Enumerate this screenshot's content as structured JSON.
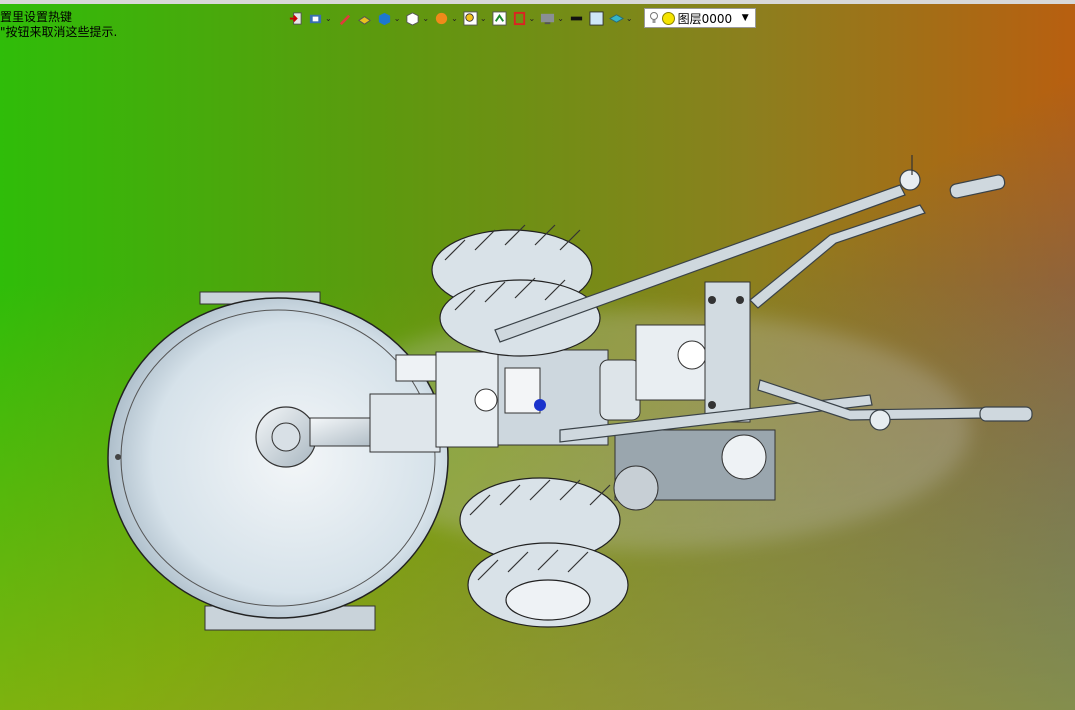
{
  "hint": {
    "line1": "置里设置热键",
    "line2": "\"按钮来取消这些提示."
  },
  "layer": {
    "label": "图层0000"
  },
  "toolbar": {
    "icons": [
      "exit-icon",
      "view-orient-icon",
      "sketch-pen-icon",
      "solid-icon",
      "box-icon",
      "cube-icon",
      "texture-icon",
      "zoom-icon",
      "fit-icon",
      "section-icon",
      "display-icon",
      "line-color-icon",
      "fill-color-icon",
      "layer-state-icon",
      "bulb-icon",
      "layer-color-icon"
    ]
  },
  "colors": {
    "accent_bg_left": "#2fbd09",
    "accent_bg_right": "#b85f10",
    "model_light": "#e8eef2",
    "model_dark": "#5f6a72",
    "selection_point": "#1a33cc"
  }
}
